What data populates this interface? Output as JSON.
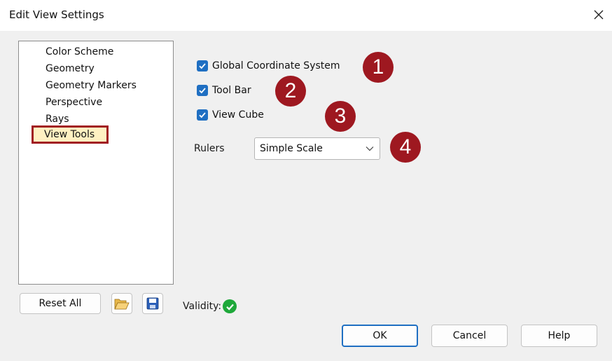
{
  "window": {
    "title": "Edit View Settings",
    "close_glyph": "✕"
  },
  "categories": [
    {
      "label": "Color Scheme",
      "selected": false
    },
    {
      "label": "Geometry",
      "selected": false
    },
    {
      "label": "Geometry Markers",
      "selected": false
    },
    {
      "label": "Perspective",
      "selected": false
    },
    {
      "label": "Rays",
      "selected": false
    },
    {
      "label": "View Tools",
      "selected": true
    }
  ],
  "options": {
    "global_coordinate_system": {
      "label": "Global Coordinate System",
      "checked": true
    },
    "tool_bar": {
      "label": "Tool Bar",
      "checked": true
    },
    "view_cube": {
      "label": "View Cube",
      "checked": true
    },
    "rulers": {
      "label": "Rulers",
      "value": "Simple Scale"
    }
  },
  "callouts": [
    "1",
    "2",
    "3",
    "4"
  ],
  "footer": {
    "reset_all_label": "Reset All",
    "open_icon": "folder-open-icon",
    "save_icon": "floppy-disk-icon",
    "validity_label": "Validity:",
    "validity_status": "valid",
    "ok_label": "OK",
    "cancel_label": "Cancel",
    "help_label": "Help"
  },
  "colors": {
    "accent": "#1f6fc2",
    "callout": "#9e1820",
    "selection_fill": "#fff1c2",
    "selection_outline": "#a11a22",
    "valid": "#1ea83a"
  }
}
